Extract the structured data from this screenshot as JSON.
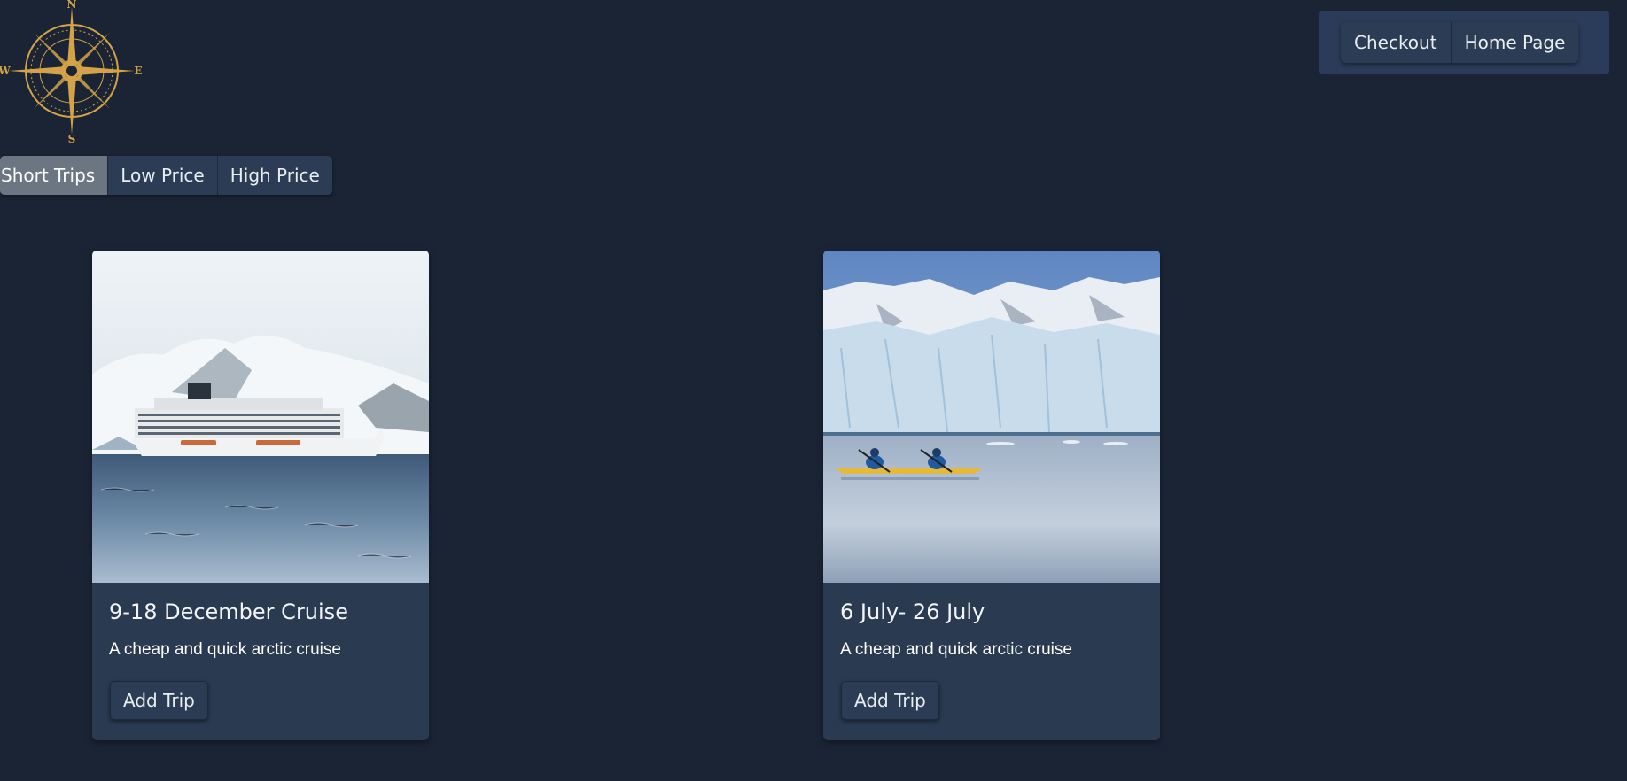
{
  "logo": {
    "icon": "compass-rose",
    "letters": {
      "n": "N",
      "s": "S",
      "e": "E",
      "w": "W"
    },
    "color": "#d4a348"
  },
  "filters": {
    "items": [
      {
        "label": "Short Trips",
        "active": true
      },
      {
        "label": "Low Price",
        "active": false
      },
      {
        "label": "High Price",
        "active": false
      }
    ]
  },
  "nav": {
    "checkout_label": "Checkout",
    "home_label": "Home Page"
  },
  "trips": [
    {
      "image": "cruise-ship-in-icy-sea",
      "title": "9-18 December Cruise",
      "description": "A cheap and quick arctic cruise",
      "button_label": "Add Trip"
    },
    {
      "image": "kayaks-near-glacier",
      "title": "6 July- 26 July",
      "description": "A cheap and quick arctic cruise",
      "button_label": "Add Trip"
    }
  ],
  "colors": {
    "background": "#1a2435",
    "card": "#2a3a51",
    "button": "#2c3c54",
    "active_filter": "#6c7582",
    "gold": "#d4a348"
  }
}
